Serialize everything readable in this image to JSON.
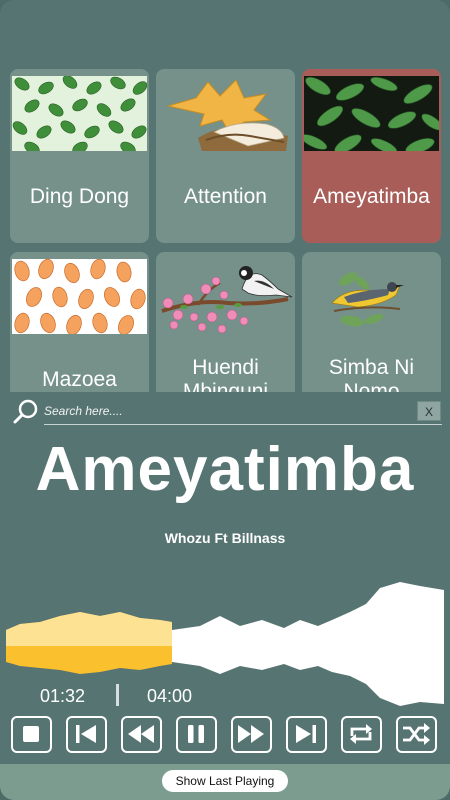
{
  "songs": [
    {
      "title": "Ding Dong",
      "art": "green-leaves-art"
    },
    {
      "title": "Attention",
      "art": "autumn-leaf-book-art"
    },
    {
      "title": "Ameyatimba",
      "art": "dark-leaves-art",
      "active": true
    },
    {
      "title": "Mazoea",
      "art": "orange-leaves-art"
    },
    {
      "title": "Huendi Mbinguni",
      "art": "blossom-bird-art"
    },
    {
      "title": "Simba Ni Nomo",
      "art": "yellow-bird-art"
    }
  ],
  "search": {
    "placeholder": "Search here....",
    "clear_label": "X"
  },
  "now_playing": {
    "title": "Ameyatimba",
    "artist": "Whozu Ft Billnass",
    "current_time": "01:32",
    "total_time": "04:00",
    "progress_fraction": 0.38
  },
  "controls": [
    "stop-icon",
    "skip-previous-icon",
    "rewind-icon",
    "pause-icon",
    "fast-forward-icon",
    "skip-next-icon",
    "repeat-icon",
    "shuffle-icon"
  ],
  "footer": {
    "show_last_label": "Show Last Playing"
  },
  "colors": {
    "background": "#567472",
    "card": "#75918a",
    "card_active": "#a85d58",
    "progress": "#fbc02d",
    "progress_light": "#fde7a6",
    "wave": "#ffffff"
  }
}
